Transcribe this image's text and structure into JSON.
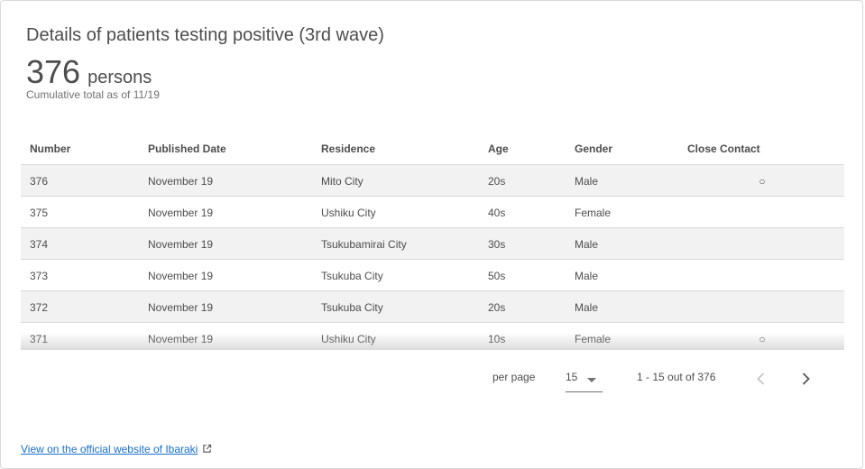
{
  "header": {
    "title": "Details of patients testing positive (3rd wave)",
    "count": "376",
    "unit": "persons",
    "subtitle": "Cumulative total as of 11/19"
  },
  "table": {
    "columns": [
      "Number",
      "Published Date",
      "Residence",
      "Age",
      "Gender",
      "Close Contact"
    ],
    "rows": [
      {
        "number": "376",
        "date": "November 19",
        "residence": "Mito City",
        "age": "20s",
        "gender": "Male",
        "close_contact": "○"
      },
      {
        "number": "375",
        "date": "November 19",
        "residence": "Ushiku City",
        "age": "40s",
        "gender": "Female",
        "close_contact": ""
      },
      {
        "number": "374",
        "date": "November 19",
        "residence": "Tsukubamirai City",
        "age": "30s",
        "gender": "Male",
        "close_contact": ""
      },
      {
        "number": "373",
        "date": "November 19",
        "residence": "Tsukuba City",
        "age": "50s",
        "gender": "Male",
        "close_contact": ""
      },
      {
        "number": "372",
        "date": "November 19",
        "residence": "Tsukuba City",
        "age": "20s",
        "gender": "Male",
        "close_contact": ""
      },
      {
        "number": "371",
        "date": "November 19",
        "residence": "Ushiku City",
        "age": "10s",
        "gender": "Female",
        "close_contact": "○"
      }
    ]
  },
  "pagination": {
    "per_page_label": "per page",
    "per_page_value": "15",
    "range_text": "1 - 15 out of 376",
    "prev_icon": "chevron-left-icon",
    "next_icon": "chevron-right-icon"
  },
  "footer": {
    "link_text": "View on the official website of Ibaraki",
    "link_icon": "external-link-icon"
  },
  "colors": {
    "text": "#4d4d4d",
    "row_stripe": "#f2f2f2",
    "link": "#1a6fc7"
  }
}
